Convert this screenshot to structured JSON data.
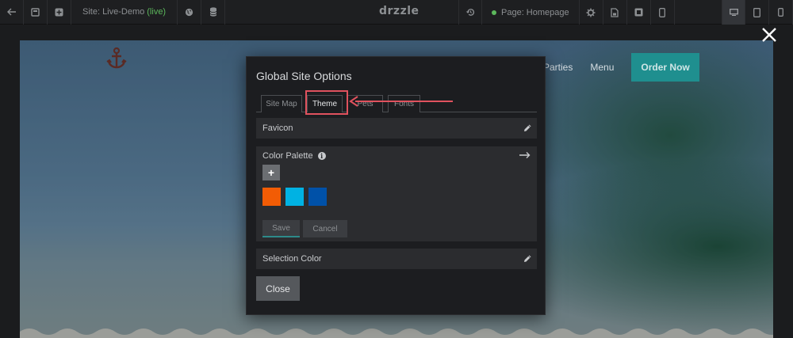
{
  "toolbar": {
    "site_prefix": "Site: Live-Demo",
    "site_status": "(live)",
    "logo": "drzzle",
    "page_label": "Page: Homepage",
    "icons": [
      "back-arrow-icon",
      "pages-icon",
      "add-icon",
      "globe-icon",
      "database-icon",
      "history-icon",
      "gear-icon",
      "save-icon",
      "publish-icon",
      "mobile-icon",
      "desktop-icon",
      "tablet-icon",
      "phone-icon"
    ]
  },
  "site_preview": {
    "nav_items": [
      "Parties",
      "Menu"
    ],
    "order_button": "Order Now"
  },
  "modal": {
    "title": "Global Site Options",
    "tabs": [
      "Site Map",
      "Theme",
      "Pets",
      "Fonts"
    ],
    "active_tab": "Theme",
    "favicon_label": "Favicon",
    "color_palette_label": "Color Palette",
    "add_label": "+",
    "swatches": [
      "#f25c05",
      "#00b2e3",
      "#0051a8"
    ],
    "save_label": "Save",
    "cancel_label": "Cancel",
    "selection_color_label": "Selection Color",
    "close_label": "Close"
  },
  "colors": {
    "accent": "#1f8f8f",
    "highlight": "#e0525e",
    "live": "#5cb85c"
  }
}
